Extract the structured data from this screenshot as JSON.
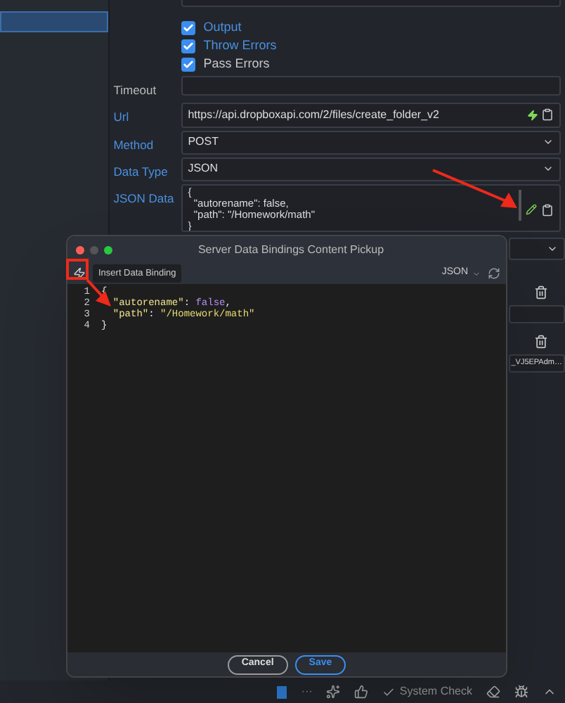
{
  "sidebar": {
    "items": [
      {
        "selected": true
      }
    ]
  },
  "options": [
    {
      "label": "Output",
      "checked": true
    },
    {
      "label": "Throw Errors",
      "checked": true
    },
    {
      "label": "Pass Errors",
      "checked": true
    }
  ],
  "fields": [
    {
      "label": "Timeout",
      "kind": "text",
      "highlight": false
    },
    {
      "label": "Url",
      "kind": "url",
      "value": "https://api.dropboxapi.com/2/files/create_folder_v2",
      "highlight": true
    },
    {
      "label": "Method",
      "kind": "select",
      "value": "POST",
      "highlight": true
    },
    {
      "label": "Data Type",
      "kind": "select",
      "value": "JSON",
      "highlight": true
    },
    {
      "label": "JSON Data",
      "kind": "json",
      "lines": [
        "{",
        "  \"autorename\": false,",
        "  \"path\": \"/Homework/math\"",
        "}"
      ],
      "highlight": true
    }
  ],
  "hidden_rows": [
    {
      "kind": "select"
    },
    {
      "kind": "delete"
    },
    {
      "kind": "field"
    },
    {
      "kind": "delete"
    },
    {
      "kind": "field",
      "value": "_VJ5EPAdm…"
    }
  ],
  "dialog": {
    "title": "Server Data Bindings Content Pickup",
    "tooltip": "Insert Data Binding",
    "mode": "JSON",
    "code": [
      {
        "number": "1",
        "tokens": [
          {
            "kind": "punct",
            "text": "{"
          }
        ]
      },
      {
        "number": "2",
        "tokens": [
          {
            "kind": "key",
            "text": "  \"autorename\""
          },
          {
            "kind": "punct",
            "text": ": "
          },
          {
            "kind": "bool",
            "text": "false"
          },
          {
            "kind": "punct",
            "text": ","
          }
        ]
      },
      {
        "number": "3",
        "tokens": [
          {
            "kind": "key",
            "text": "  \"path\""
          },
          {
            "kind": "punct",
            "text": ": "
          },
          {
            "kind": "string",
            "text": "\"/Homework/math\""
          }
        ]
      },
      {
        "number": "4",
        "tokens": [
          {
            "kind": "punct",
            "text": "}"
          }
        ]
      }
    ],
    "buttons": [
      {
        "label": "Cancel",
        "kind": "secondary"
      },
      {
        "label": "Save",
        "kind": "primary"
      }
    ]
  },
  "status_bar": {
    "items": [
      {
        "kind": "square"
      },
      {
        "kind": "dots",
        "text": "···"
      },
      {
        "kind": "sparkle"
      },
      {
        "kind": "thumb"
      },
      {
        "kind": "check",
        "text": "System Check"
      },
      {
        "kind": "eraser"
      },
      {
        "kind": "bug"
      },
      {
        "kind": "chevron"
      }
    ]
  }
}
